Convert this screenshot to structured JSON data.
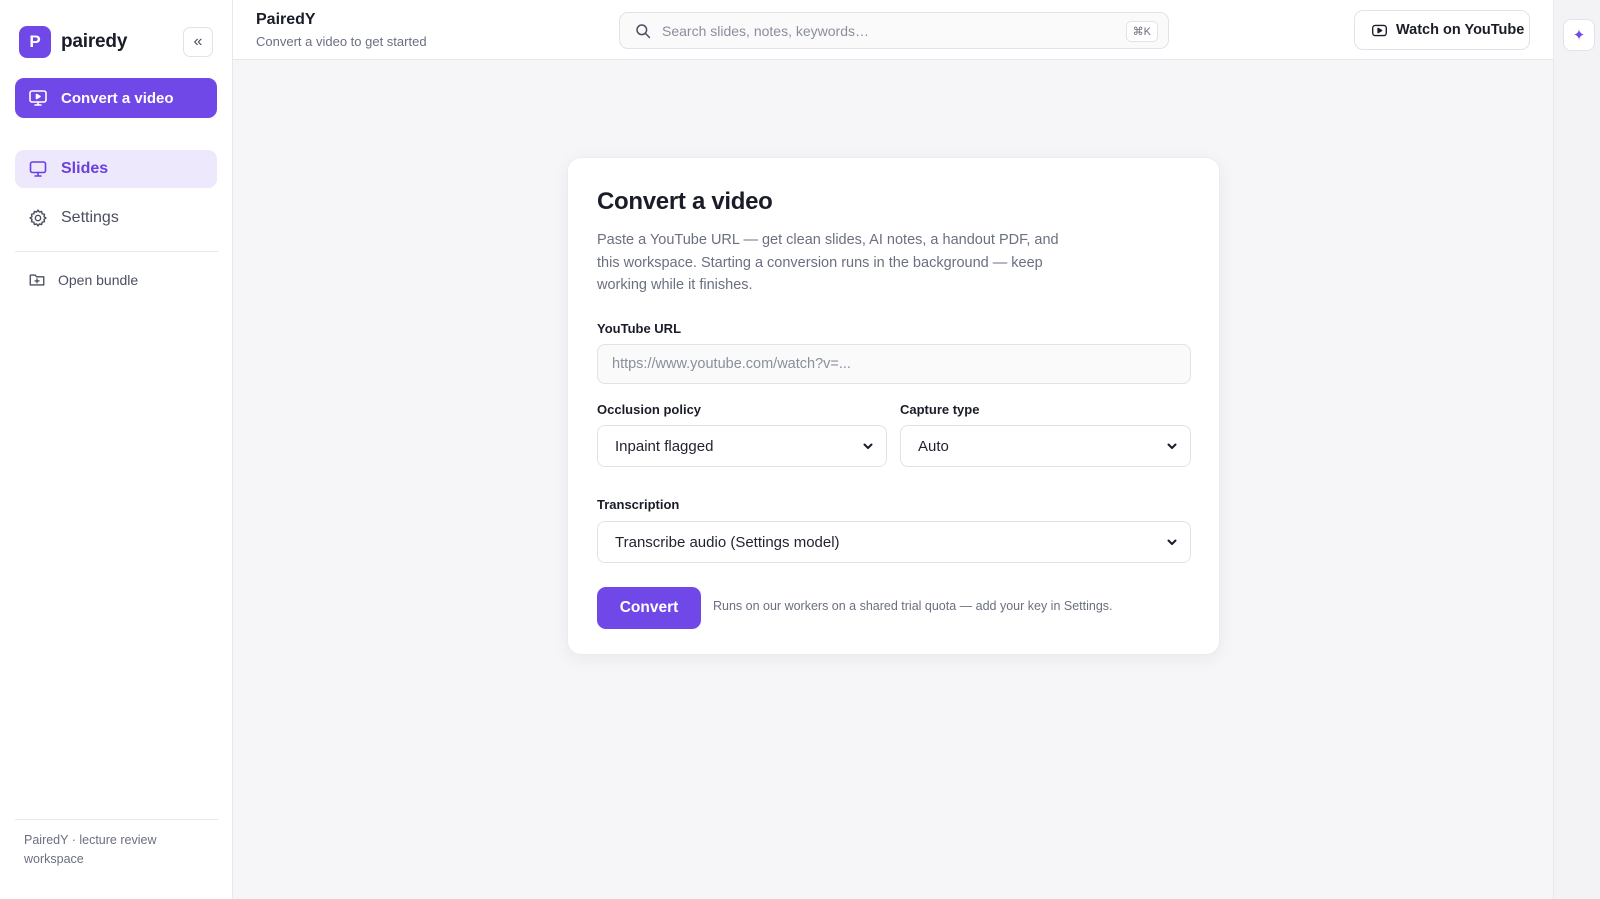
{
  "sidebar": {
    "brand": {
      "logo_letter": "P",
      "name": "pairedy"
    },
    "collapse_label": "«",
    "cta_label": "Convert a video",
    "nav": [
      {
        "label": "Slides",
        "icon": "monitor-icon",
        "active": true
      },
      {
        "label": "Settings",
        "icon": "gear-icon",
        "active": false
      }
    ],
    "open_bundle_label": "Open bundle",
    "footer": "PairedY · lecture review workspace"
  },
  "header": {
    "title": "PairedY",
    "subtitle": "Convert a video to get started",
    "search_placeholder": "Search slides, notes, keywords…",
    "search_shortcut": "⌘K",
    "youtube_button": "Watch on YouTube"
  },
  "rail": {
    "assistant_icon": "✦"
  },
  "form": {
    "title": "Convert a video",
    "description": "Paste a YouTube URL — get clean slides, AI notes, a handout PDF, and this workspace. Starting a conversion runs in the background — keep working while it finishes.",
    "url_label": "YouTube URL",
    "url_placeholder": "https://www.youtube.com/watch?v=...",
    "url_value": "",
    "occlusion_label": "Occlusion policy",
    "occlusion_value": "Inpaint flagged",
    "capture_label": "Capture type",
    "capture_value": "Auto",
    "transcription_label": "Transcription",
    "transcription_value": "Transcribe audio (Settings model)",
    "submit_label": "Convert",
    "submit_note": "Runs on our workers on a shared trial quota — add your key in Settings."
  },
  "colors": {
    "accent": "#7048e8",
    "accent_soft": "#ede8fb",
    "background": "#f6f6f8"
  }
}
